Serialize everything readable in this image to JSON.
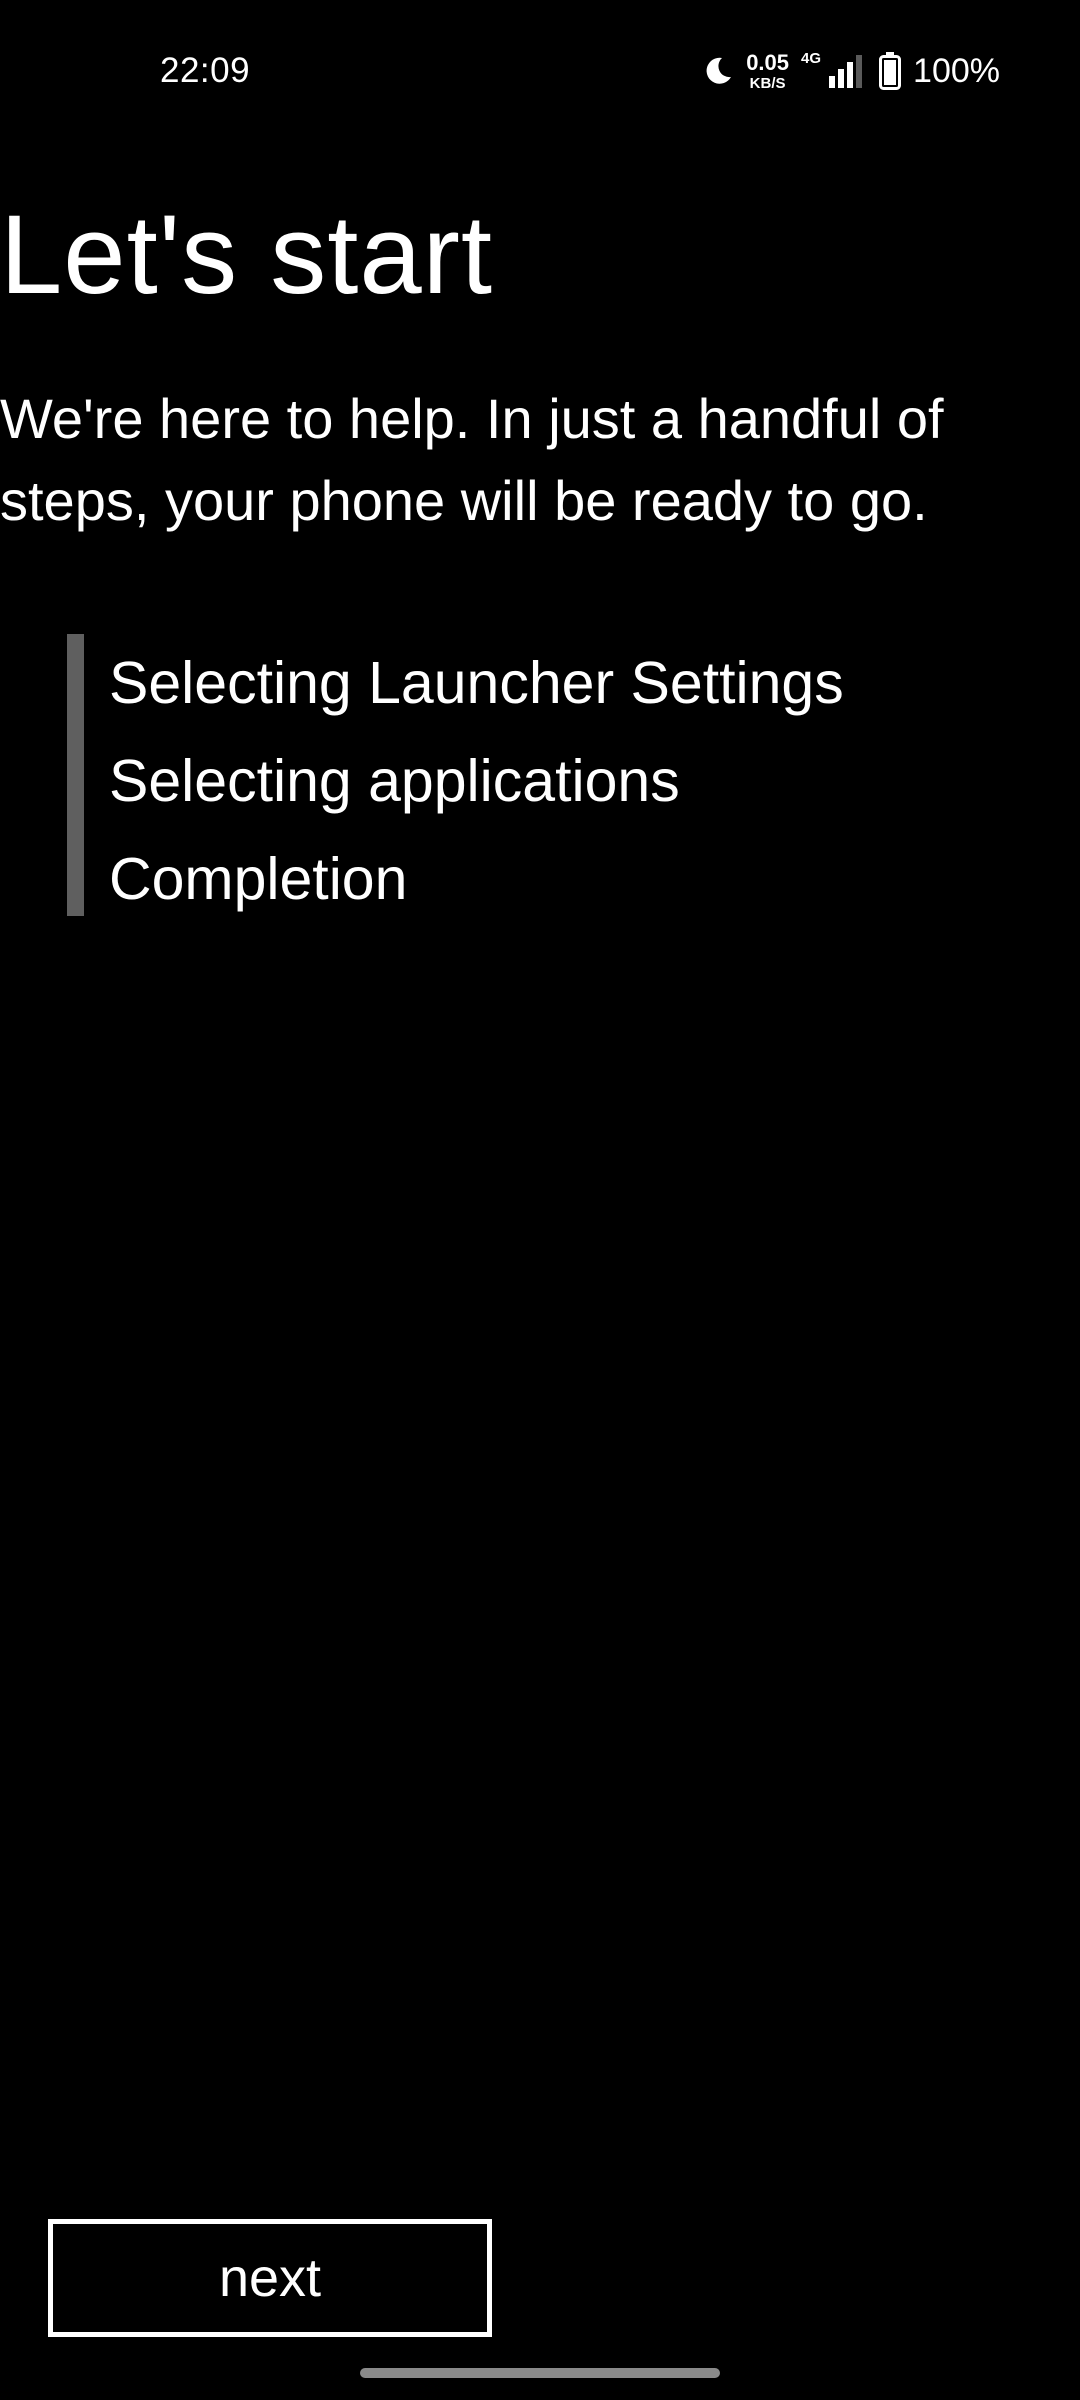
{
  "status_bar": {
    "time": "22:09",
    "network_speed": "0.05",
    "network_speed_unit": "KB/S",
    "network_type": "4G",
    "battery_percent": "100%",
    "icons": [
      "moon-icon",
      "signal-icon",
      "battery-icon"
    ]
  },
  "page": {
    "title": "Let's start",
    "subtitle": "We're here to help. In just a handful of steps, your phone will be ready to go."
  },
  "steps": [
    {
      "label": "Selecting Launcher Settings"
    },
    {
      "label": "Selecting applications"
    },
    {
      "label": "Completion"
    }
  ],
  "actions": {
    "next_label": "next"
  },
  "colors": {
    "background": "#000000",
    "text": "#ffffff",
    "steps_bar": "#5f5f5f"
  }
}
